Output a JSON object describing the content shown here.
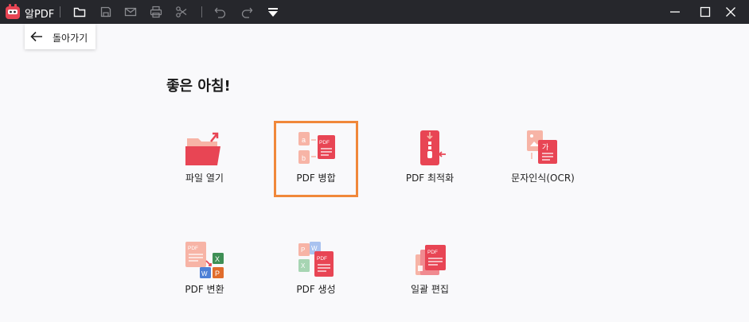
{
  "app": {
    "name": "알PDF"
  },
  "nav": {
    "back_label": "돌아가기"
  },
  "greeting": "좋은 아침!",
  "tiles": [
    {
      "label": "파일 열기",
      "icon": "folder-open-icon"
    },
    {
      "label": "PDF 병합",
      "icon": "merge-icon"
    },
    {
      "label": "PDF 최적화",
      "icon": "compress-icon"
    },
    {
      "label": "문자인식(OCR)",
      "icon": "ocr-icon"
    },
    {
      "label": "PDF 변환",
      "icon": "convert-icon"
    },
    {
      "label": "PDF 생성",
      "icon": "create-icon"
    },
    {
      "label": "일괄 편집",
      "icon": "batch-edit-icon"
    }
  ],
  "icon_text": {
    "a": "a",
    "b": "b",
    "pdf": "PDF",
    "ga": "가",
    "x": "X",
    "w": "W",
    "p": "P"
  },
  "colors": {
    "accent": "#e84554",
    "selection": "#f0883a",
    "titlebar": "#26272c"
  }
}
